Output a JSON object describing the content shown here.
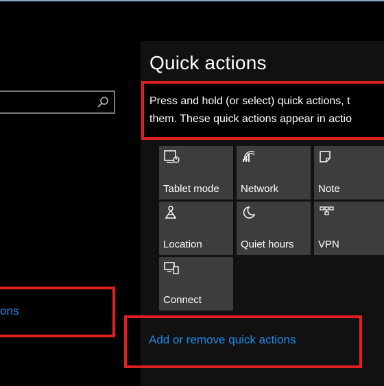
{
  "page": {
    "title": "Quick actions",
    "description_line1": "Press and hold (or select) quick actions, t",
    "description_line2": "them. These quick actions appear in actio"
  },
  "search": {
    "value": "",
    "placeholder": ""
  },
  "left_link": {
    "label": "ons"
  },
  "tiles": [
    {
      "label": "Tablet mode",
      "icon": "tablet-mode-icon"
    },
    {
      "label": "Network",
      "icon": "network-icon"
    },
    {
      "label": "Note",
      "icon": "note-icon"
    },
    {
      "label": "Location",
      "icon": "location-icon"
    },
    {
      "label": "Quiet hours",
      "icon": "quiet-hours-icon"
    },
    {
      "label": "VPN",
      "icon": "vpn-icon"
    },
    {
      "label": "Connect",
      "icon": "connect-icon"
    }
  ],
  "add_link": {
    "label": "Add or remove quick actions"
  },
  "colors": {
    "background": "#000000",
    "tile": "#3d3d3d",
    "link": "#1e88e5",
    "highlight": "#e02020"
  }
}
